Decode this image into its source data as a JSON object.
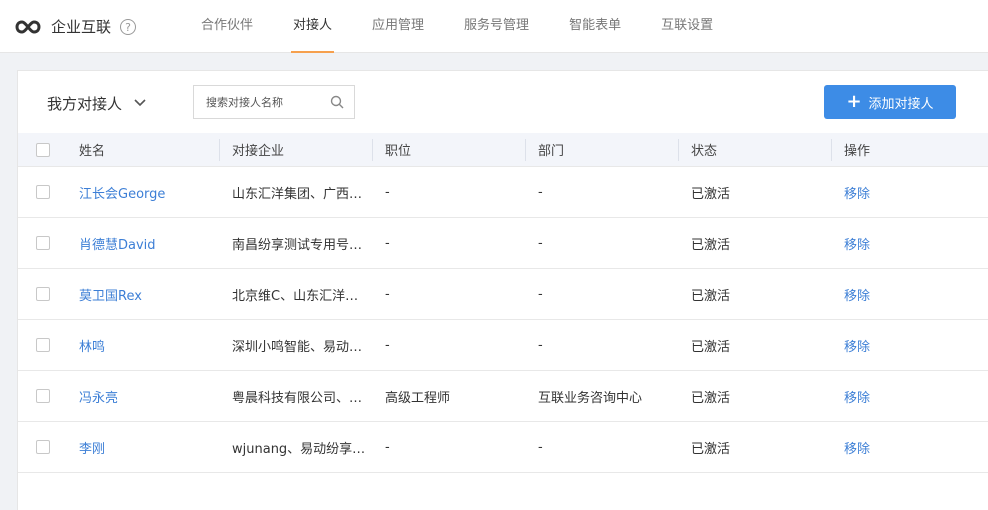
{
  "app": {
    "title": "企业互联",
    "help": "?"
  },
  "nav": {
    "tabs": [
      {
        "label": "合作伙伴"
      },
      {
        "label": "对接人"
      },
      {
        "label": "应用管理"
      },
      {
        "label": "服务号管理"
      },
      {
        "label": "智能表单"
      },
      {
        "label": "互联设置"
      }
    ],
    "active_index": 1
  },
  "toolbar": {
    "scope_label": "我方对接人",
    "search_placeholder": "搜索对接人名称",
    "add_label": "添加对接人"
  },
  "table": {
    "headers": {
      "name": "姓名",
      "company": "对接企业",
      "position": "职位",
      "dept": "部门",
      "status": "状态",
      "action": "操作"
    },
    "rows": [
      {
        "name": "江长会George",
        "company": "山东汇洋集团、广西…",
        "position": "-",
        "dept": "-",
        "status": "已激活",
        "action": "移除"
      },
      {
        "name": "肖德慧David",
        "company": "南昌纷享测试专用号…",
        "position": "-",
        "dept": "-",
        "status": "已激活",
        "action": "移除"
      },
      {
        "name": "莫卫国Rex",
        "company": "北京维C、山东汇洋…",
        "position": "-",
        "dept": "-",
        "status": "已激活",
        "action": "移除"
      },
      {
        "name": "林鸣",
        "company": "深圳小鸣智能、易动…",
        "position": "-",
        "dept": "-",
        "status": "已激活",
        "action": "移除"
      },
      {
        "name": "冯永亮",
        "company": "粤晨科技有限公司、…",
        "position": "高级工程师",
        "dept": "互联业务咨询中心",
        "status": "已激活",
        "action": "移除"
      },
      {
        "name": "李刚",
        "company": "wjunang、易动纷享…",
        "position": "-",
        "dept": "-",
        "status": "已激活",
        "action": "移除"
      }
    ]
  },
  "colors": {
    "accent": "#3d8ce6",
    "tab_underline": "#f6a04d",
    "link": "#3d7fd6"
  }
}
